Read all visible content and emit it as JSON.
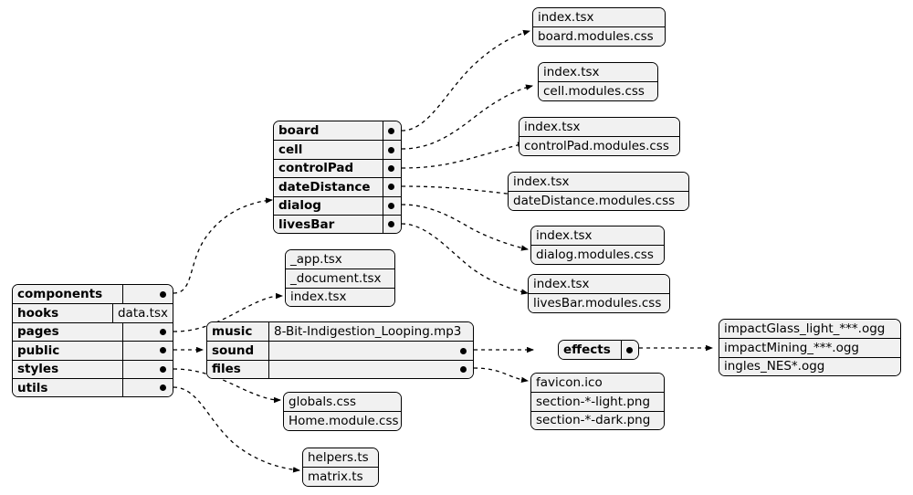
{
  "diagram": {
    "title": "project-structure-diagram",
    "background": "#ffffff",
    "node_fill": "#f1f1f1",
    "stroke": "#000000"
  },
  "nodes": {
    "root": {
      "id": "root-folders",
      "rows": [
        {
          "name": "components",
          "value": "",
          "dot": true
        },
        {
          "name": "hooks",
          "value": "data.tsx",
          "dot": false
        },
        {
          "name": "pages",
          "value": "",
          "dot": true
        },
        {
          "name": "public",
          "value": "",
          "dot": true
        },
        {
          "name": "styles",
          "value": "",
          "dot": true
        },
        {
          "name": "utils",
          "value": "",
          "dot": true
        }
      ]
    },
    "components": {
      "id": "components-list",
      "rows": [
        {
          "name": "board",
          "value": "",
          "dot": true
        },
        {
          "name": "cell",
          "value": "",
          "dot": true
        },
        {
          "name": "controlPad",
          "value": "",
          "dot": true
        },
        {
          "name": "dateDistance",
          "value": "",
          "dot": true
        },
        {
          "name": "dialog",
          "value": "",
          "dot": true
        },
        {
          "name": "livesBar",
          "value": "",
          "dot": true
        }
      ]
    },
    "board_files": {
      "id": "board-files",
      "items": [
        "index.tsx",
        "board.modules.css"
      ]
    },
    "cell_files": {
      "id": "cell-files",
      "items": [
        "index.tsx",
        "cell.modules.css"
      ]
    },
    "controlpad_files": {
      "id": "controlpad-files",
      "items": [
        "index.tsx",
        "controlPad.modules.css"
      ]
    },
    "datedistance_files": {
      "id": "datedistance-files",
      "items": [
        "index.tsx",
        "dateDistance.modules.css"
      ]
    },
    "dialog_files": {
      "id": "dialog-files",
      "items": [
        "index.tsx",
        "dialog.modules.css"
      ]
    },
    "livesbar_files": {
      "id": "livesbar-files",
      "items": [
        "index.tsx",
        "livesBar.modules.css"
      ]
    },
    "pages_files": {
      "id": "pages-files",
      "items": [
        "_app.tsx",
        "_document.tsx",
        "index.tsx"
      ]
    },
    "public": {
      "id": "public-contents",
      "rows": [
        {
          "name": "music",
          "value": "8-Bit-Indigestion_Looping.mp3",
          "dot": false
        },
        {
          "name": "sound",
          "value": "",
          "dot": true
        },
        {
          "name": "files",
          "value": "",
          "dot": true
        }
      ]
    },
    "effects": {
      "id": "effects-node",
      "rows": [
        {
          "name": "effects",
          "value": "",
          "dot": true
        }
      ]
    },
    "effects_files": {
      "id": "effects-files",
      "items": [
        "impactGlass_light_***.ogg",
        "impactMining_***.ogg",
        "ingles_NES*.ogg"
      ]
    },
    "public_files": {
      "id": "public-files",
      "items": [
        "favicon.ico",
        "section-*-light.png",
        "section-*-dark.png"
      ]
    },
    "styles_files": {
      "id": "styles-files",
      "items": [
        "globals.css",
        "Home.module.css"
      ]
    },
    "utils_files": {
      "id": "utils-files",
      "items": [
        "helpers.ts",
        "matrix.ts"
      ]
    }
  }
}
